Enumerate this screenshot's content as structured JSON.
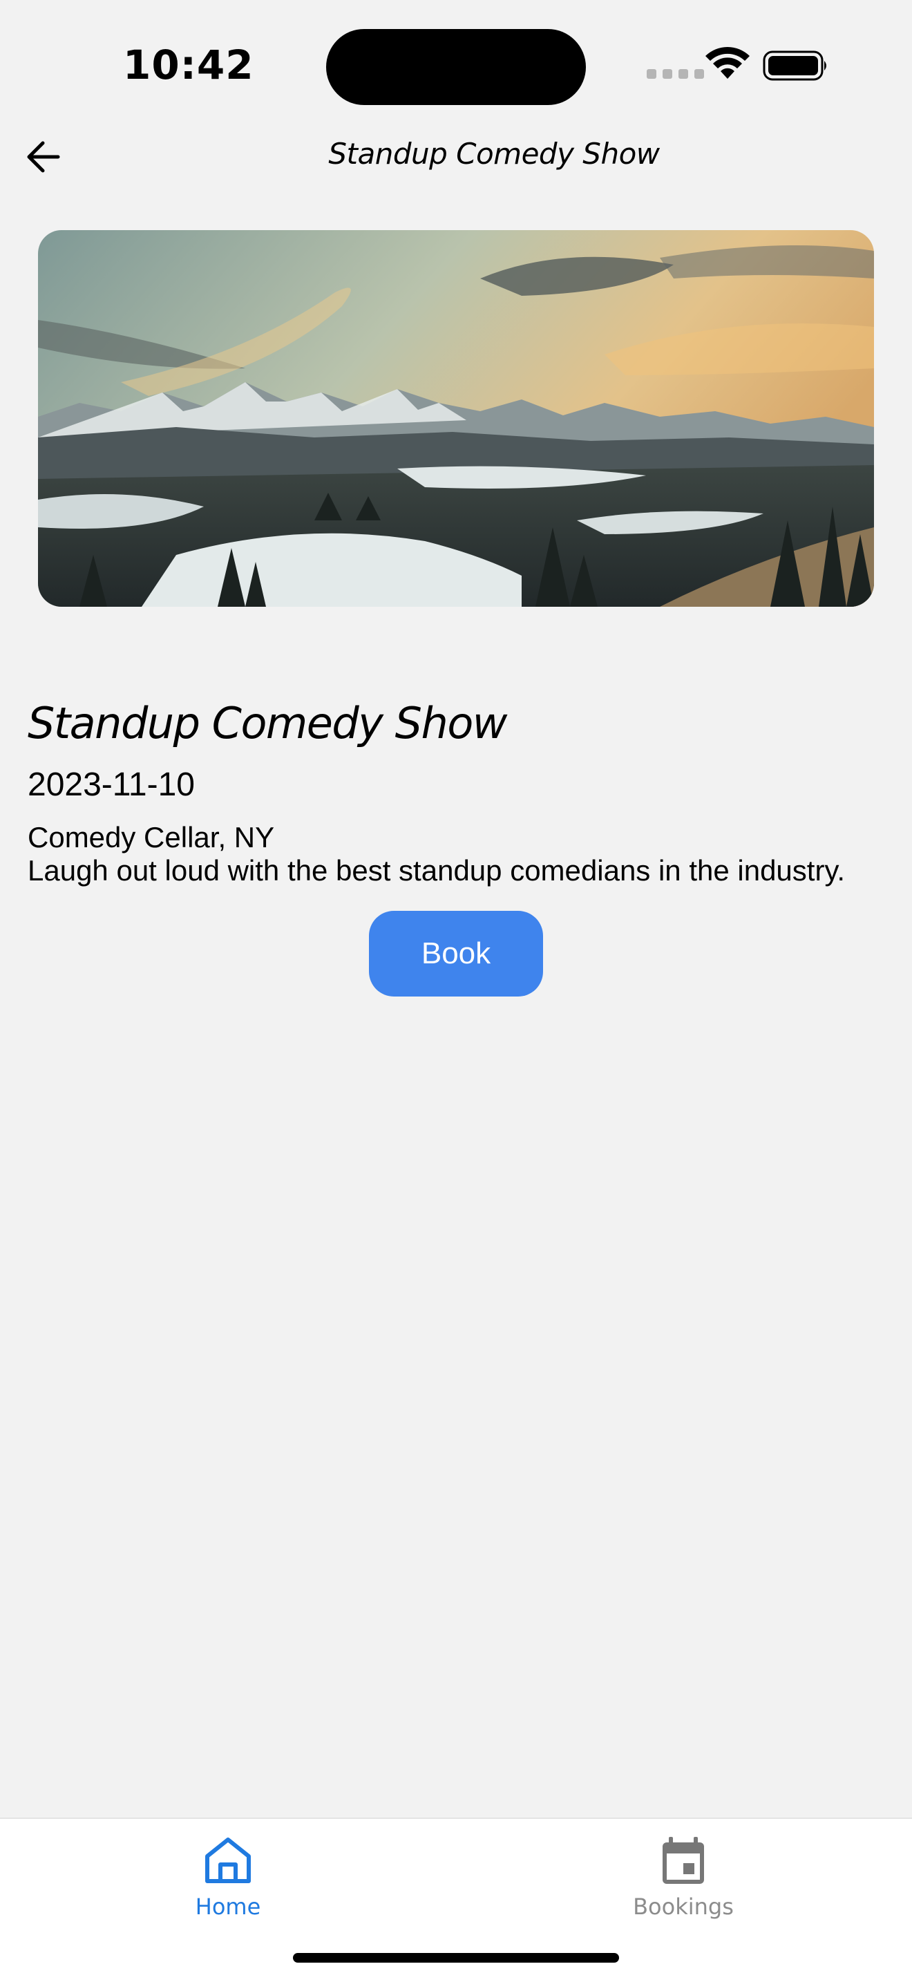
{
  "status_bar": {
    "time": "10:42",
    "icons": [
      "signal-icon",
      "wifi-icon",
      "battery-icon"
    ]
  },
  "nav": {
    "back_icon": "arrow-left-icon",
    "title": "Standup Comedy Show"
  },
  "event": {
    "image": "mountain-landscape-photo",
    "title": "Standup Comedy Show",
    "date": "2023-11-10",
    "venue": "Comedy Cellar, NY",
    "description": "Laugh out loud with the best standup comedians in the industry.",
    "book_label": "Book"
  },
  "tab_bar": {
    "tabs": [
      {
        "label": "Home",
        "icon": "home-icon",
        "active": true
      },
      {
        "label": "Bookings",
        "icon": "calendar-icon",
        "active": false
      }
    ]
  },
  "colors": {
    "background": "#f2f2f2",
    "accent": "#3f84ed",
    "tab_active": "#1f7ae0",
    "tab_inactive": "#8c8c8c"
  }
}
